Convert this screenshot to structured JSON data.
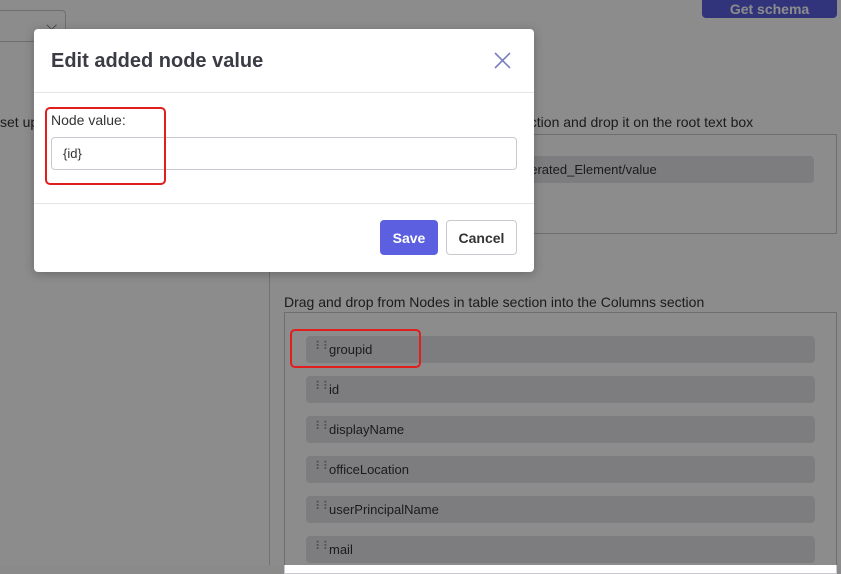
{
  "header": {
    "get_schema_label": "Get schema"
  },
  "background": {
    "left_hint": "set up",
    "root_hint": "ection and drop it on the root text box",
    "root_value": "nerated_Element/value",
    "columns_hint": "Drag and drop from Nodes in table section into the Columns section",
    "nodes": [
      {
        "label": "groupid"
      },
      {
        "label": "id"
      },
      {
        "label": "displayName"
      },
      {
        "label": "officeLocation"
      },
      {
        "label": "userPrincipalName"
      },
      {
        "label": "mail"
      }
    ]
  },
  "modal": {
    "title": "Edit added node value",
    "field_label": "Node value:",
    "field_value": "{id}",
    "save_label": "Save",
    "cancel_label": "Cancel"
  },
  "colors": {
    "accent": "#5b5fe0",
    "highlight": "#e01e1e"
  }
}
